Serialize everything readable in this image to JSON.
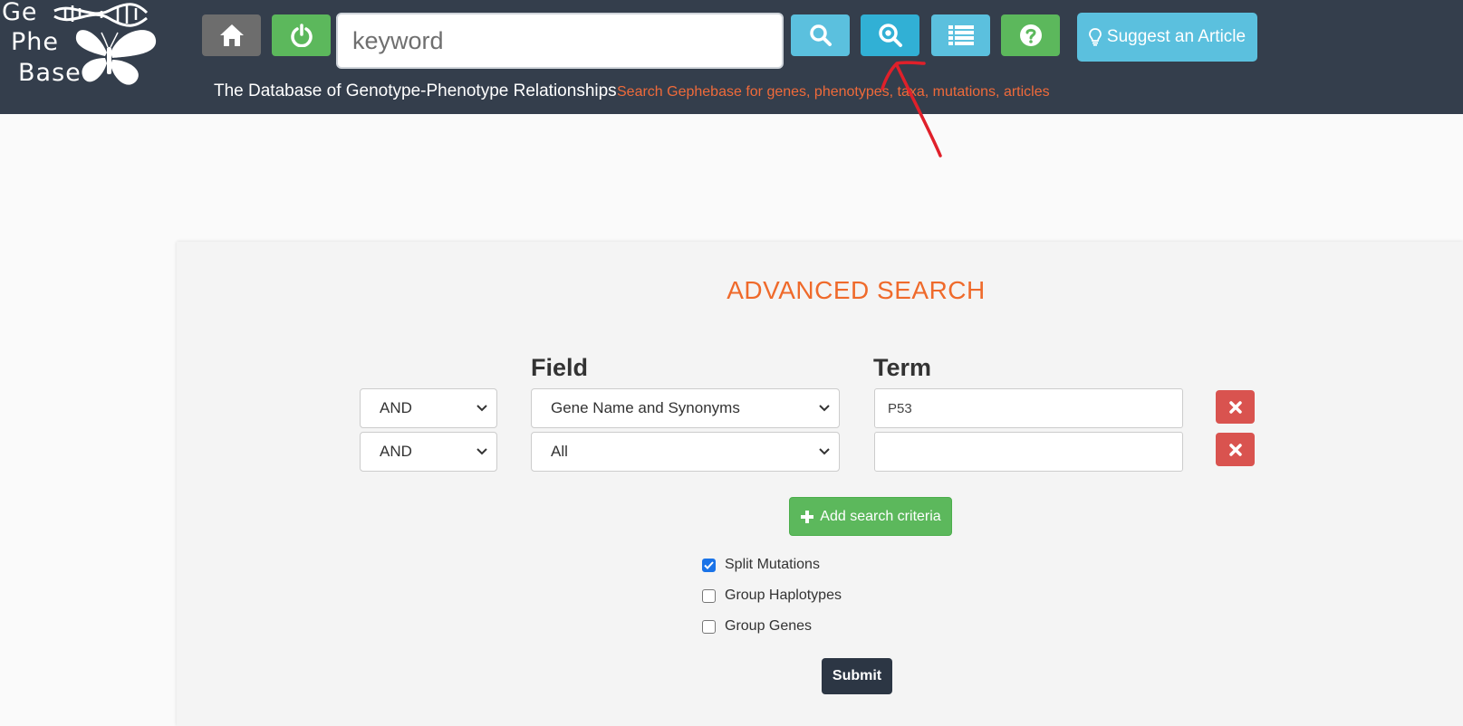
{
  "header": {
    "logo": {
      "line1": "Ge",
      "line2": "Phe",
      "line3": "Base"
    },
    "search_placeholder": "keyword",
    "suggest_label": "Suggest an Article",
    "tagline": "The Database of Genotype-Phenotype Relationships",
    "search_hint": "Search Gephebase for genes, phenotypes, taxa, mutations, articles",
    "buttons": [
      {
        "icon": "home-icon",
        "color": "#6d6d6d"
      },
      {
        "icon": "power-icon",
        "color": "#5cb85c"
      },
      {
        "icon": "search-icon",
        "color": "#5bc0de"
      },
      {
        "icon": "advanced-search-icon",
        "color": "#31b0d5"
      },
      {
        "icon": "list-icon",
        "color": "#5bc0de"
      },
      {
        "icon": "help-icon",
        "color": "#5cb85c"
      }
    ]
  },
  "advanced_search": {
    "title": "ADVANCED SEARCH",
    "field_header": "Field",
    "term_header": "Term",
    "rows": [
      {
        "operator": "AND",
        "field": "Gene Name and Synonyms",
        "term": "P53"
      },
      {
        "operator": "AND",
        "field": "All",
        "term": ""
      }
    ],
    "add_label": "Add search criteria",
    "options": [
      {
        "label": "Split Mutations",
        "checked": true
      },
      {
        "label": "Group Haplotypes",
        "checked": false
      },
      {
        "label": "Group Genes",
        "checked": false
      }
    ],
    "submit_label": "Submit"
  },
  "colors": {
    "navbar": "#343e4c",
    "accent_orange": "#ef6a2b",
    "info": "#5bc0de",
    "success": "#5cb85c",
    "danger": "#d9534f",
    "annotation_red": "#e0202a"
  }
}
